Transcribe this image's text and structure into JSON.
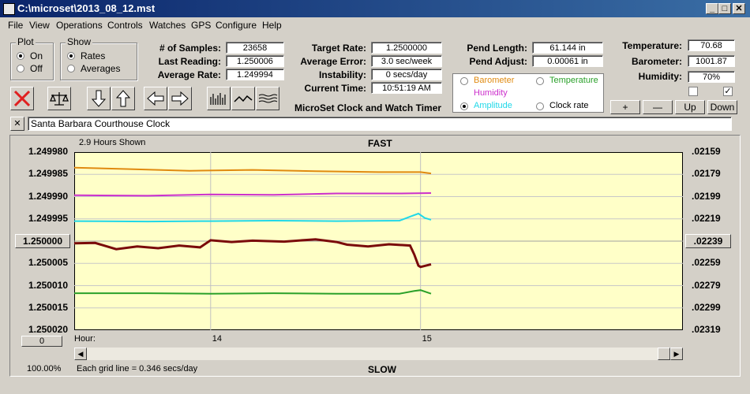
{
  "window": {
    "title": "C:\\microset\\2013_08_12.mst",
    "min": "_",
    "max": "□",
    "close": "✕"
  },
  "menu": [
    "File",
    "View",
    "Operations",
    "Controls",
    "Watches",
    "GPS",
    "Configure",
    "Help"
  ],
  "plot": {
    "label": "Plot",
    "on": "On",
    "off": "Off",
    "selected": "On"
  },
  "show": {
    "label": "Show",
    "rates": "Rates",
    "averages": "Averages",
    "selected": "Rates"
  },
  "stats": {
    "samples_label": "# of Samples:",
    "samples": "23658",
    "last_label": "Last Reading:",
    "last": "1.250006",
    "avg_label": "Average Rate:",
    "avg": "1.249994",
    "target_label": "Target Rate:",
    "target": "1.2500000",
    "avgerr_label": "Average Error:",
    "avgerr": "3.0 sec/week",
    "instab_label": "Instability:",
    "instab": "0 secs/day",
    "time_label": "Current Time:",
    "time": "10:51:19 AM",
    "pendlen_label": "Pend Length:",
    "pendlen": "61.144 in",
    "pendadj_label": "Pend Adjust:",
    "pendadj": "0.00061 in",
    "temp_label": "Temperature:",
    "temp": "70.68",
    "baro_label": "Barometer:",
    "baro": "1001.87",
    "hum_label": "Humidity:",
    "hum": "70%"
  },
  "app_caption": "MicroSet Clock and Watch Timer",
  "legend": {
    "barometer": "Barometer",
    "temperature": "Temperature",
    "humidity": "Humidity",
    "amplitude": "Amplitude",
    "clockrate": "Clock rate",
    "selected": "Amplitude"
  },
  "colors": {
    "barometer": "#e08a10",
    "temperature": "#2aa02a",
    "humidity": "#cc30cc",
    "amplitude": "#20d8e8",
    "clockrate": "#7a0a0a",
    "plot_bg": "#ffffc8"
  },
  "small_buttons": {
    "plus": "+",
    "minus": "—",
    "up": "Up",
    "down": "Down"
  },
  "checkboxes": {
    "left": false,
    "right": true
  },
  "clock_name": "Santa Barbara Courthouse Clock",
  "clear_button": "✕",
  "chart": {
    "top_label": "FAST",
    "bottom_label": "SLOW",
    "overlay_text": "2.9 Hours Shown",
    "center_left": "1.250000",
    "center_right": ".02239",
    "bottom_left_btn": "0",
    "hour_label": "Hour:",
    "zoom": "100.00%",
    "grid_note": "Each grid line = 0.346 secs/day"
  },
  "chart_data": {
    "type": "line",
    "left_axis_ticks": [
      "1.249980",
      "1.249985",
      "1.249990",
      "1.249995",
      "1.250000",
      "1.250005",
      "1.250010",
      "1.250015",
      "1.250020"
    ],
    "right_axis_ticks": [
      ".02159",
      ".02179",
      ".02199",
      ".02219",
      ".02239",
      ".02259",
      ".02279",
      ".02299",
      ".02319"
    ],
    "x_ticks": [
      "14",
      "15"
    ],
    "x_tick_hours": [
      14,
      15
    ],
    "x_range": [
      13.35,
      16.25
    ],
    "ylim": [
      1.24998,
      1.25002
    ],
    "grid": true,
    "series": [
      {
        "name": "Barometer",
        "color": "#e08a10",
        "x": [
          13.35,
          13.6,
          13.9,
          14.2,
          14.5,
          14.8,
          15.0,
          15.05
        ],
        "y": [
          1.2499835,
          1.2499838,
          1.2499842,
          1.249984,
          1.2499843,
          1.2499845,
          1.2499845,
          1.2499848
        ]
      },
      {
        "name": "Humidity",
        "color": "#cc30cc",
        "x": [
          13.35,
          13.7,
          14.0,
          14.3,
          14.6,
          14.9,
          15.05
        ],
        "y": [
          1.2499897,
          1.2499898,
          1.2499895,
          1.2499896,
          1.2499893,
          1.2499893,
          1.2499892
        ]
      },
      {
        "name": "Amplitude",
        "color": "#20d8e8",
        "x": [
          13.35,
          13.7,
          14.0,
          14.3,
          14.6,
          14.9,
          14.95,
          14.99,
          15.02,
          15.05
        ],
        "y": [
          1.2499955,
          1.2499956,
          1.2499955,
          1.2499954,
          1.2499955,
          1.2499954,
          1.2499945,
          1.2499938,
          1.2499948,
          1.2499952
        ]
      },
      {
        "name": "Clock rate",
        "color": "#7a0a0a",
        "x": [
          13.35,
          13.45,
          13.55,
          13.65,
          13.75,
          13.85,
          13.95,
          14.0,
          14.1,
          14.2,
          14.35,
          14.5,
          14.6,
          14.65,
          14.75,
          14.85,
          14.95,
          14.97,
          14.99,
          15.0,
          15.05
        ],
        "y": [
          1.2500005,
          1.2500004,
          1.2500018,
          1.2500012,
          1.2500016,
          1.250001,
          1.2500014,
          1.2499998,
          1.2500002,
          1.2499999,
          1.2500001,
          1.2499996,
          1.2500002,
          1.2500008,
          1.2500012,
          1.2500007,
          1.250001,
          1.250003,
          1.2500055,
          1.2500058,
          1.2500052
        ]
      },
      {
        "name": "Temperature",
        "color": "#2aa02a",
        "x": [
          13.35,
          13.7,
          14.0,
          14.3,
          14.6,
          14.9,
          14.97,
          15.0,
          15.05
        ],
        "y": [
          1.2500117,
          1.2500117,
          1.2500118,
          1.2500117,
          1.2500118,
          1.2500118,
          1.2500112,
          1.250011,
          1.2500118
        ]
      }
    ]
  }
}
